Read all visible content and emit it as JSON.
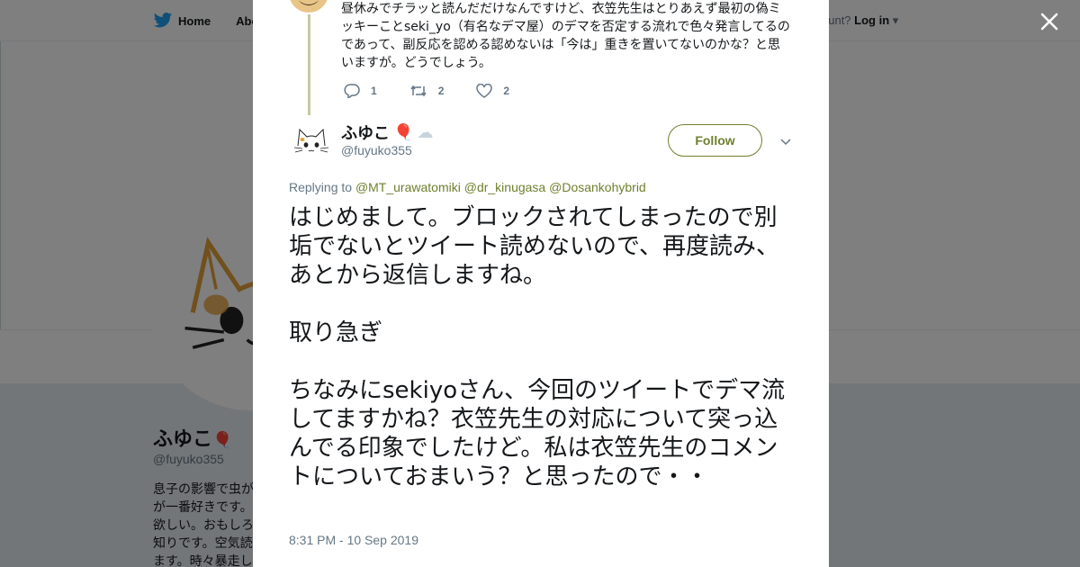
{
  "background": {
    "nav": {
      "home_label": "Home",
      "about_label": "Abo"
    },
    "login": {
      "prompt": "ccount?",
      "link_label": "Log in"
    },
    "profile": {
      "name": "ふゆこ",
      "handle": "@fuyuko355",
      "bio": "息子の影響で虫が\nが一番好きです。\n欲しい。おもしろ\n知りです。空気読\nます。時々暴走し"
    }
  },
  "modal": {
    "parent_tweet": {
      "text": "昼休みでチラッと読んだだけなんですけど、衣笠先生はとりあえず最初の偽ミッキーことseki_yo（有名なデマ屋）のデマを否定する流れで色々発言してるのであって、副反応を認める認めないは「今は」重きを置いてないのかな？と思いますが。どうでしょう。",
      "reply_count": "1",
      "retweet_count": "2",
      "like_count": "2"
    },
    "tweet": {
      "author_name": "ふゆこ",
      "name_emojis": [
        "🎈",
        "☁"
      ],
      "author_handle": "@fuyuko355",
      "follow_label": "Follow",
      "replying_prefix": "Replying to",
      "mentions": [
        "@MT_urawatomiki",
        "@dr_kinugasa",
        "@Dosankohybrid"
      ],
      "text": "はじめまして。ブロックされてしまったので別垢でないとツイート読めないので、再度読み、あとから返信しますね。\n\n取り急ぎ\n\nちなみにsekiyoさん、今回のツイートでデマ流してますかね？衣笠先生の対応について突っ込んでる印象でしたけど。私は衣笠先生のコメントについておまいう？と思ったので・・",
      "timestamp": "8:31 PM - 10 Sep 2019"
    }
  },
  "colors": {
    "accent": "#6f7f2e",
    "thread_line": "#c5c8a3",
    "muted_text": "#657786"
  },
  "icons": [
    "twitter-bird-icon",
    "close-icon",
    "reply-icon",
    "retweet-icon",
    "like-icon",
    "chevron-down-icon",
    "balloon-emoji-icon",
    "cloud-emoji-icon"
  ]
}
